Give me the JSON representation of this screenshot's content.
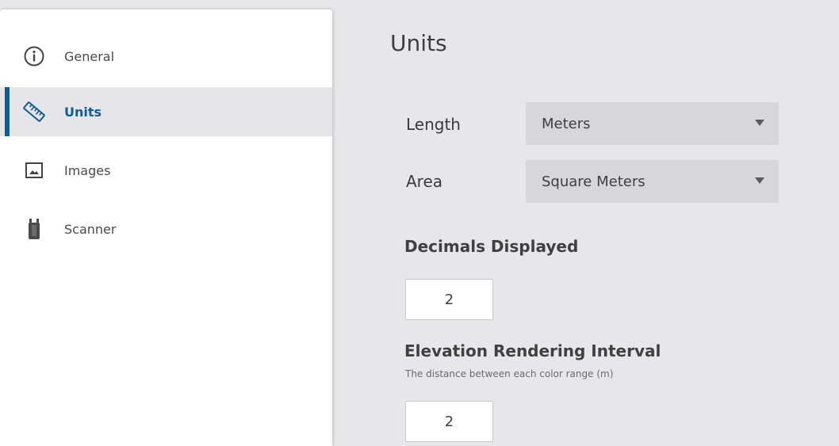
{
  "sidebar": {
    "items": [
      {
        "label": "General",
        "icon": "info-icon",
        "active": false
      },
      {
        "label": "Units",
        "icon": "ruler-icon",
        "active": true
      },
      {
        "label": "Images",
        "icon": "image-icon",
        "active": false
      },
      {
        "label": "Scanner",
        "icon": "scanner-icon",
        "active": false
      }
    ],
    "accent_color": "#0f5d97"
  },
  "main": {
    "title": "Units",
    "length": {
      "label": "Length",
      "value": "Meters"
    },
    "area": {
      "label": "Area",
      "value": "Square Meters"
    },
    "decimals": {
      "title": "Decimals Displayed",
      "value": "2"
    },
    "elevation": {
      "title": "Elevation Rendering Interval",
      "subtitle": "The distance between each color range (m)",
      "value": "2"
    }
  }
}
